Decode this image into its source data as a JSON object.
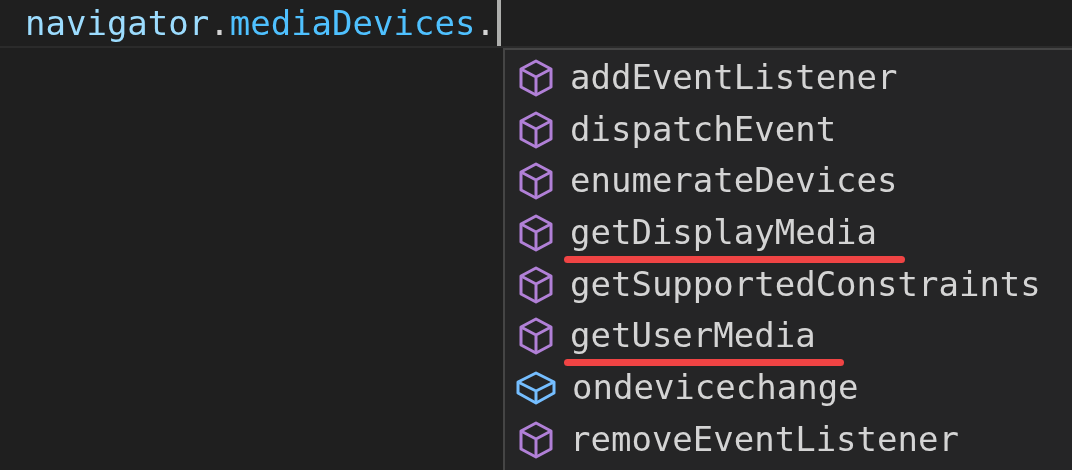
{
  "editor": {
    "code_line": [
      {
        "text": "navigator",
        "kind": "variable",
        "separator": "."
      },
      {
        "text": "mediaDevices",
        "kind": "property",
        "separator": "."
      }
    ]
  },
  "suggestions": [
    {
      "label": "addEventListener",
      "kind": "method",
      "underlined": false
    },
    {
      "label": "dispatchEvent",
      "kind": "method",
      "underlined": false
    },
    {
      "label": "enumerateDevices",
      "kind": "method",
      "underlined": false
    },
    {
      "label": "getDisplayMedia",
      "kind": "method",
      "underlined": true
    },
    {
      "label": "getSupportedConstraints",
      "kind": "method",
      "underlined": false
    },
    {
      "label": "getUserMedia",
      "kind": "method",
      "underlined": true
    },
    {
      "label": "ondevicechange",
      "kind": "field",
      "underlined": false
    },
    {
      "label": "removeEventListener",
      "kind": "method",
      "underlined": false
    }
  ]
}
